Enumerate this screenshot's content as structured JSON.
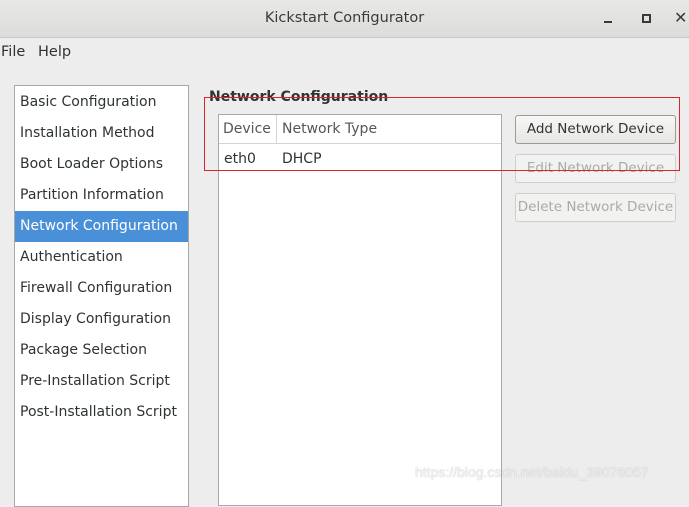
{
  "window": {
    "title": "Kickstart Configurator"
  },
  "menubar": {
    "items": [
      "File",
      "Help"
    ]
  },
  "sidebar": {
    "selected": "Network Configuration",
    "items": [
      "Basic Configuration",
      "Installation Method",
      "Boot Loader Options",
      "Partition Information",
      "Network Configuration",
      "Authentication",
      "Firewall Configuration",
      "Display Configuration",
      "Package Selection",
      "Pre-Installation Script",
      "Post-Installation Script"
    ]
  },
  "main": {
    "title": "Network Configuration",
    "table": {
      "columns": [
        "Device",
        "Network Type"
      ],
      "rows": [
        [
          "eth0",
          "DHCP"
        ]
      ]
    },
    "buttons": {
      "add": "Add Network Device",
      "edit": "Edit Network Device",
      "delete": "Delete Network Device"
    }
  },
  "annotation": {
    "highlight_color": "#d9262c"
  },
  "watermark": "https://blog.csdn.net/baidu_39076057",
  "colors": {
    "selection": "#4a90d9"
  }
}
